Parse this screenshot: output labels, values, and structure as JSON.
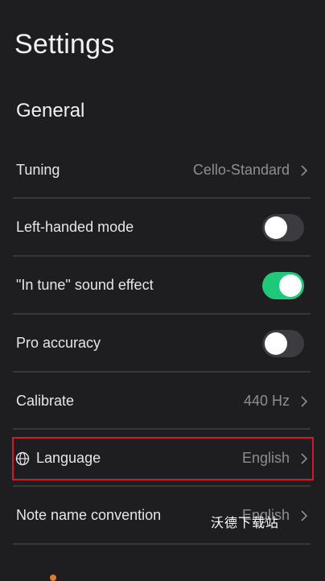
{
  "header": {
    "title": "Settings"
  },
  "section": {
    "title": "General"
  },
  "rows": {
    "tuning": {
      "label": "Tuning",
      "value": "Cello-Standard"
    },
    "left_handed": {
      "label": "Left-handed mode",
      "enabled": false
    },
    "in_tune_sound": {
      "label": "\"In tune\" sound effect",
      "enabled": true
    },
    "pro_accuracy": {
      "label": "Pro accuracy",
      "enabled": false
    },
    "calibrate": {
      "label": "Calibrate",
      "value": "440 Hz"
    },
    "language": {
      "label": "Language",
      "value": "English",
      "icon": "globe-icon"
    },
    "note_name": {
      "label": "Note name convention",
      "value": "English"
    }
  },
  "watermark": {
    "text": "沃德下载站"
  },
  "colors": {
    "background": "#1e1e20",
    "toggle_on": "#1ec97a",
    "toggle_off": "#3c3c40",
    "highlight_border": "#d0192c"
  }
}
